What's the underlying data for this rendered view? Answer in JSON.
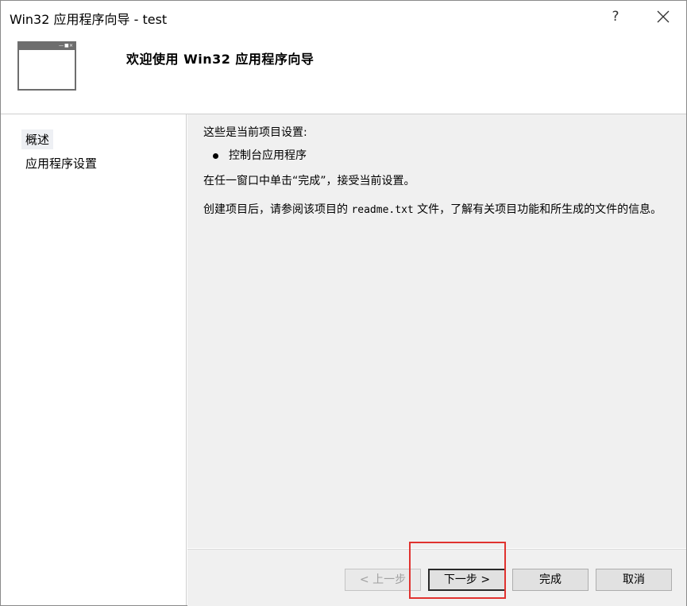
{
  "window": {
    "title": "Win32 应用程序向导 - test",
    "help_label": "?"
  },
  "banner": {
    "icon": "window-icon",
    "title": "欢迎使用 Win32 应用程序向导"
  },
  "nav": {
    "items": [
      {
        "label": "概述",
        "selected": true
      },
      {
        "label": "应用程序设置",
        "selected": false
      }
    ]
  },
  "content": {
    "heading": "这些是当前项目设置:",
    "bullets": [
      "控制台应用程序"
    ],
    "instruction": "在任一窗口中单击“完成”，接受当前设置。",
    "info_prefix": "创建项目后，请参阅该项目的 ",
    "info_file": "readme.txt",
    "info_suffix": " 文件，了解有关项目功能和所生成的文件的信息。"
  },
  "buttons": {
    "back": "< 上一步",
    "next": "下一步 >",
    "finish": "完成",
    "cancel": "取消"
  },
  "colors": {
    "highlight": "#e0322f",
    "panel": "#f0f0f0"
  }
}
